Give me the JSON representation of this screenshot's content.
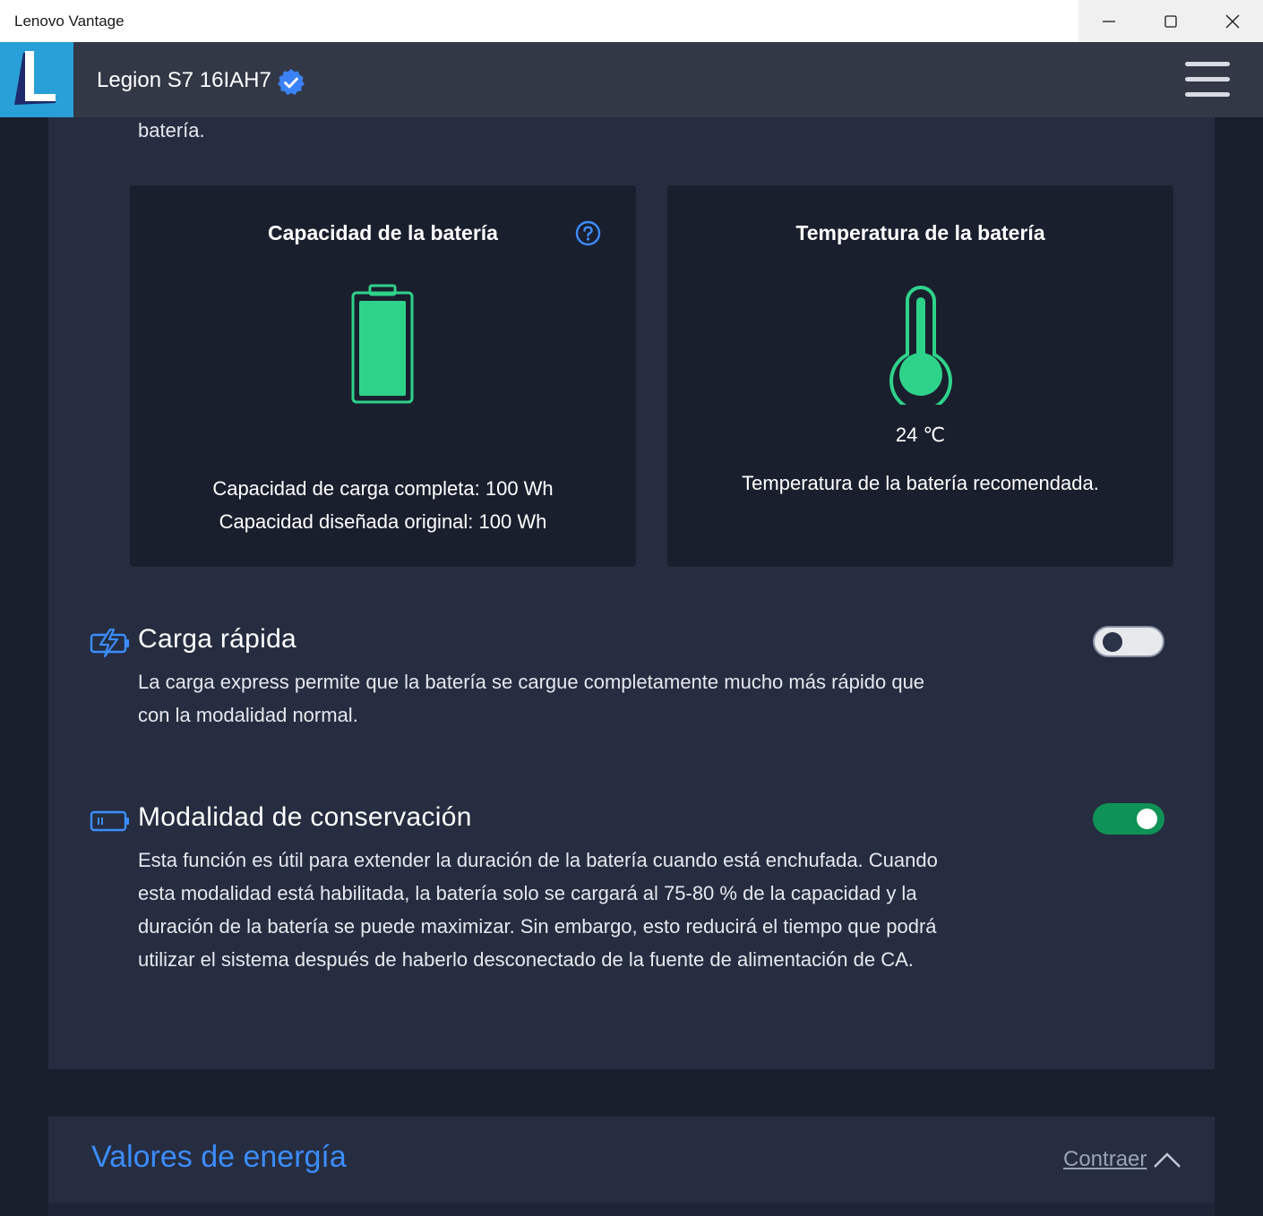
{
  "window": {
    "title": "Lenovo Vantage"
  },
  "header": {
    "device_name": "Legion S7 16IAH7"
  },
  "intro_tail": "batería.",
  "battery_capacity": {
    "title": "Capacidad de la batería",
    "full_charge": "Capacidad de carga completa: 100 Wh",
    "design": "Capacidad diseñada original: 100 Wh"
  },
  "battery_temperature": {
    "title": "Temperatura de la batería",
    "value": "24 ℃",
    "status": "Temperatura de la batería recomendada."
  },
  "rapid_charge": {
    "title": "Carga rápida",
    "description": "La carga express permite que la batería se cargue completamente mucho más rápido que con la modalidad normal.",
    "enabled": false
  },
  "conservation_mode": {
    "title": "Modalidad de conservación",
    "description": "Esta función es útil para extender la duración de la batería cuando está enchufada. Cuando esta modalidad está habilitada, la batería solo se cargará al 75-80 % de la capacidad y la duración de la batería se puede maximizar. Sin embargo, esto reducirá el tiempo que podrá utilizar el sistema después de haberlo desconectado de la fuente de alimentación de CA.",
    "enabled": true
  },
  "power_settings": {
    "title": "Valores de energía",
    "collapse_label": "Contraer"
  },
  "colors": {
    "accent_blue": "#3b8dff",
    "battery_green": "#2ed38a",
    "toggle_on": "#0f9255"
  }
}
